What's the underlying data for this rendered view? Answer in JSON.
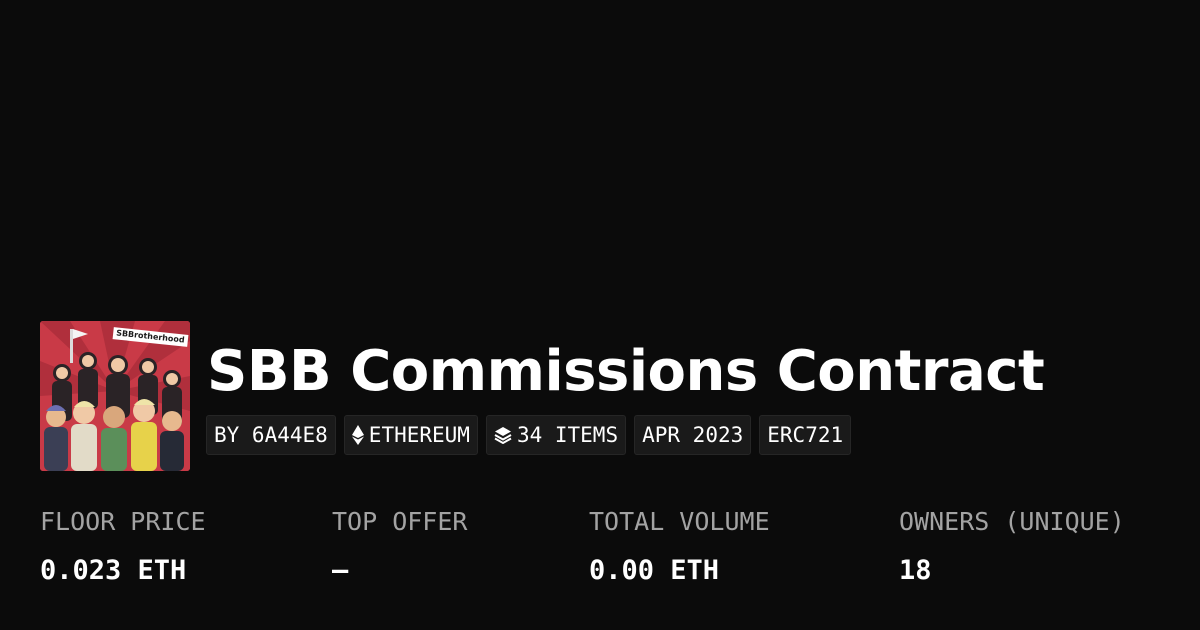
{
  "collection": {
    "title": "SBB Commissions Contract",
    "avatar_text": "SBBrotherhood",
    "avatar_color": "#c93a47"
  },
  "chips": {
    "creator": "BY 6A44E8",
    "chain": "ETHEREUM",
    "chain_icon": "ethereum-icon",
    "items": "34 ITEMS",
    "items_icon": "layers-icon",
    "date": "APR 2023",
    "standard": "ERC721"
  },
  "stats": {
    "floor_price": {
      "label": "FLOOR PRICE",
      "value": "0.023 ETH"
    },
    "top_offer": {
      "label": "TOP OFFER",
      "value": "–"
    },
    "total_volume": {
      "label": "TOTAL VOLUME",
      "value": "0.00 ETH"
    },
    "owners": {
      "label": "OWNERS (UNIQUE)",
      "value": "18"
    }
  },
  "colors": {
    "background": "#0b0b0b",
    "chip_background": "#1a1a1a",
    "label_gray": "#a3a3a3",
    "text": "#ffffff"
  }
}
